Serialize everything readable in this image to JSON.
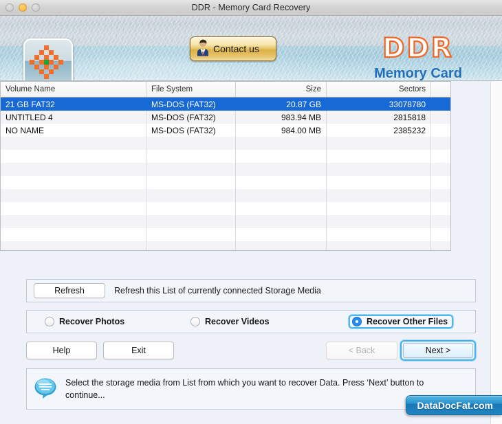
{
  "window": {
    "title": "DDR - Memory Card Recovery",
    "traffic_lights": [
      "close",
      "minimize",
      "zoom"
    ]
  },
  "header": {
    "app_icon": "memory-card-icon",
    "contact_button": {
      "label": "Contact us",
      "icon": "person-icon"
    },
    "brand": {
      "line1": "DDR",
      "line2": "Memory Card",
      "ddr_color": "#f26522",
      "memory_card_color": "#1f6fb8"
    }
  },
  "table": {
    "columns": [
      "Volume Name",
      "File System",
      "Size",
      "Sectors"
    ],
    "rows": [
      {
        "volume_name": "21 GB FAT32",
        "file_system": "MS-DOS (FAT32)",
        "size": "20.87  GB",
        "sectors": "33078780",
        "selected": true
      },
      {
        "volume_name": "UNTITLED 4",
        "file_system": "MS-DOS (FAT32)",
        "size": "983.94  MB",
        "sectors": "2815818",
        "selected": false
      },
      {
        "volume_name": "NO NAME",
        "file_system": "MS-DOS (FAT32)",
        "size": "984.00  MB",
        "sectors": "2385232",
        "selected": false
      }
    ],
    "empty_row_count": 9,
    "selection_color": "#1769d6"
  },
  "refresh_row": {
    "button_label": "Refresh",
    "description": "Refresh this List of currently connected Storage Media"
  },
  "recovery_options": {
    "items": [
      {
        "label": "Recover Photos",
        "selected": false
      },
      {
        "label": "Recover Videos",
        "selected": false
      },
      {
        "label": "Recover Other Files",
        "selected": true
      }
    ],
    "focus_ring_color": "#4fb6ef"
  },
  "actions": {
    "help_label": "Help",
    "exit_label": "Exit",
    "back_label": "< Back",
    "back_disabled": true,
    "next_label": "Next >",
    "next_focused": true
  },
  "info": {
    "icon": "speech-bubble-icon",
    "message": "Select the storage media from List from which you want to recover Data. Press ‘Next’ button to continue..."
  },
  "watermark": {
    "text": "DataDocFat.com"
  }
}
